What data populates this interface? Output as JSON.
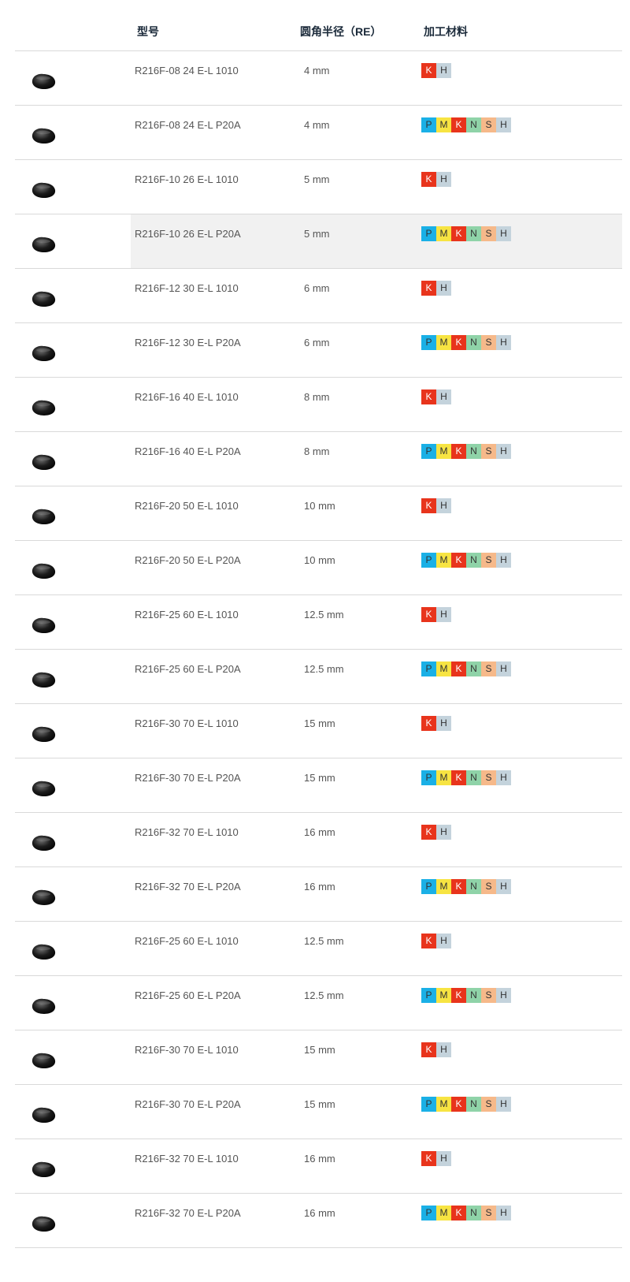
{
  "header": {
    "model": "型号",
    "radius": "圆角半径（RE）",
    "materials": "加工材料"
  },
  "material_colors": {
    "P": "#1ab0e6",
    "M": "#f7e442",
    "K": "#e8341c",
    "N": "#8fd3a8",
    "S": "#f6b98a",
    "H": "#c4d3dc"
  },
  "rows": [
    {
      "model": "R216F-08 24 E-L 1010",
      "radius": "4 mm",
      "materials": [
        "K",
        "H"
      ]
    },
    {
      "model": "R216F-08 24 E-L P20A",
      "radius": "4 mm",
      "materials": [
        "P",
        "M",
        "K",
        "N",
        "S",
        "H"
      ]
    },
    {
      "model": "R216F-10 26 E-L 1010",
      "radius": "5 mm",
      "materials": [
        "K",
        "H"
      ]
    },
    {
      "model": "R216F-10 26 E-L P20A",
      "radius": "5 mm",
      "materials": [
        "P",
        "M",
        "K",
        "N",
        "S",
        "H"
      ],
      "highlighted": true
    },
    {
      "model": "R216F-12 30 E-L 1010",
      "radius": "6 mm",
      "materials": [
        "K",
        "H"
      ]
    },
    {
      "model": "R216F-12 30 E-L P20A",
      "radius": "6 mm",
      "materials": [
        "P",
        "M",
        "K",
        "N",
        "S",
        "H"
      ]
    },
    {
      "model": "R216F-16 40 E-L 1010",
      "radius": "8 mm",
      "materials": [
        "K",
        "H"
      ]
    },
    {
      "model": "R216F-16 40 E-L P20A",
      "radius": "8 mm",
      "materials": [
        "P",
        "M",
        "K",
        "N",
        "S",
        "H"
      ]
    },
    {
      "model": "R216F-20 50 E-L 1010",
      "radius": "10 mm",
      "materials": [
        "K",
        "H"
      ]
    },
    {
      "model": "R216F-20 50 E-L P20A",
      "radius": "10 mm",
      "materials": [
        "P",
        "M",
        "K",
        "N",
        "S",
        "H"
      ]
    },
    {
      "model": "R216F-25 60 E-L 1010",
      "radius": "12.5 mm",
      "materials": [
        "K",
        "H"
      ]
    },
    {
      "model": "R216F-25 60 E-L P20A",
      "radius": "12.5 mm",
      "materials": [
        "P",
        "M",
        "K",
        "N",
        "S",
        "H"
      ]
    },
    {
      "model": "R216F-30 70 E-L 1010",
      "radius": "15 mm",
      "materials": [
        "K",
        "H"
      ]
    },
    {
      "model": "R216F-30 70 E-L P20A",
      "radius": "15 mm",
      "materials": [
        "P",
        "M",
        "K",
        "N",
        "S",
        "H"
      ]
    },
    {
      "model": "R216F-32 70 E-L 1010",
      "radius": "16 mm",
      "materials": [
        "K",
        "H"
      ]
    },
    {
      "model": "R216F-32 70 E-L P20A",
      "radius": "16 mm",
      "materials": [
        "P",
        "M",
        "K",
        "N",
        "S",
        "H"
      ]
    },
    {
      "model": "R216F-25 60 E-L 1010",
      "radius": "12.5 mm",
      "materials": [
        "K",
        "H"
      ]
    },
    {
      "model": "R216F-25 60 E-L P20A",
      "radius": "12.5 mm",
      "materials": [
        "P",
        "M",
        "K",
        "N",
        "S",
        "H"
      ]
    },
    {
      "model": "R216F-30 70 E-L 1010",
      "radius": "15 mm",
      "materials": [
        "K",
        "H"
      ]
    },
    {
      "model": "R216F-30 70 E-L P20A",
      "radius": "15 mm",
      "materials": [
        "P",
        "M",
        "K",
        "N",
        "S",
        "H"
      ]
    },
    {
      "model": "R216F-32 70 E-L 1010",
      "radius": "16 mm",
      "materials": [
        "K",
        "H"
      ]
    },
    {
      "model": "R216F-32 70 E-L P20A",
      "radius": "16 mm",
      "materials": [
        "P",
        "M",
        "K",
        "N",
        "S",
        "H"
      ]
    }
  ]
}
